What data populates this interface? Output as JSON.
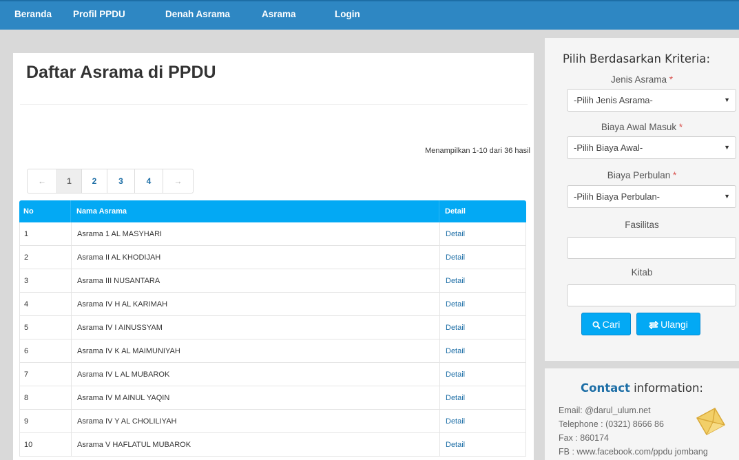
{
  "nav": {
    "items": [
      "Beranda",
      "Profil PPDU",
      "Denah Asrama",
      "Asrama",
      "Login"
    ]
  },
  "main": {
    "title": "Daftar Asrama di PPDU",
    "summary": "Menampilkan 1-10 dari 36 hasil",
    "pagination": {
      "prev": "←",
      "pages": [
        "1",
        "2",
        "3",
        "4"
      ],
      "next": "→",
      "active": "1"
    },
    "table": {
      "headers": {
        "no": "No",
        "name": "Nama Asrama",
        "detail": "Detail"
      },
      "rows": [
        {
          "no": "1",
          "name": "Asrama 1 AL MASYHARI",
          "detail": "Detail"
        },
        {
          "no": "2",
          "name": "Asrama II AL KHODIJAH",
          "detail": "Detail"
        },
        {
          "no": "3",
          "name": "Asrama III NUSANTARA",
          "detail": "Detail"
        },
        {
          "no": "4",
          "name": "Asrama IV H AL KARIMAH",
          "detail": "Detail"
        },
        {
          "no": "5",
          "name": "Asrama IV I AINUSSYAM",
          "detail": "Detail"
        },
        {
          "no": "6",
          "name": "Asrama IV K AL MAIMUNIYAH",
          "detail": "Detail"
        },
        {
          "no": "7",
          "name": "Asrama IV L AL MUBAROK",
          "detail": "Detail"
        },
        {
          "no": "8",
          "name": "Asrama IV M AINUL YAQIN",
          "detail": "Detail"
        },
        {
          "no": "9",
          "name": "Asrama IV Y AL CHOLILIYAH",
          "detail": "Detail"
        },
        {
          "no": "10",
          "name": "Asrama V HAFLATUL MUBAROK",
          "detail": "Detail"
        }
      ]
    }
  },
  "filter": {
    "title": "Pilih Berdasarkan Kriteria:",
    "jenis_label": "Jenis Asrama",
    "jenis_value": "-Pilih Jenis Asrama-",
    "biaya_awal_label": "Biaya Awal Masuk",
    "biaya_awal_value": "-Pilih Biaya Awal-",
    "biaya_bulan_label": "Biaya Perbulan",
    "biaya_bulan_value": "-Pilih Biaya Perbulan-",
    "required_mark": "*",
    "fasilitas_label": "Fasilitas",
    "fasilitas_value": "",
    "kitab_label": "Kitab",
    "kitab_value": "",
    "search_label": "Cari",
    "reset_label": "Ulangi"
  },
  "contact": {
    "title_highlight": "Contact",
    "title_rest": " information:",
    "email": "Email: @darul_ulum.net",
    "telephone": "Telephone : (0321) 8666 86",
    "fax": "Fax : 860174",
    "fb": "FB : www.facebook.com/ppdu jombang"
  },
  "colors": {
    "navbar": "#2e87c3",
    "table_header": "#03a9f4",
    "link": "#1d6ea6",
    "required": "#d9534f"
  }
}
